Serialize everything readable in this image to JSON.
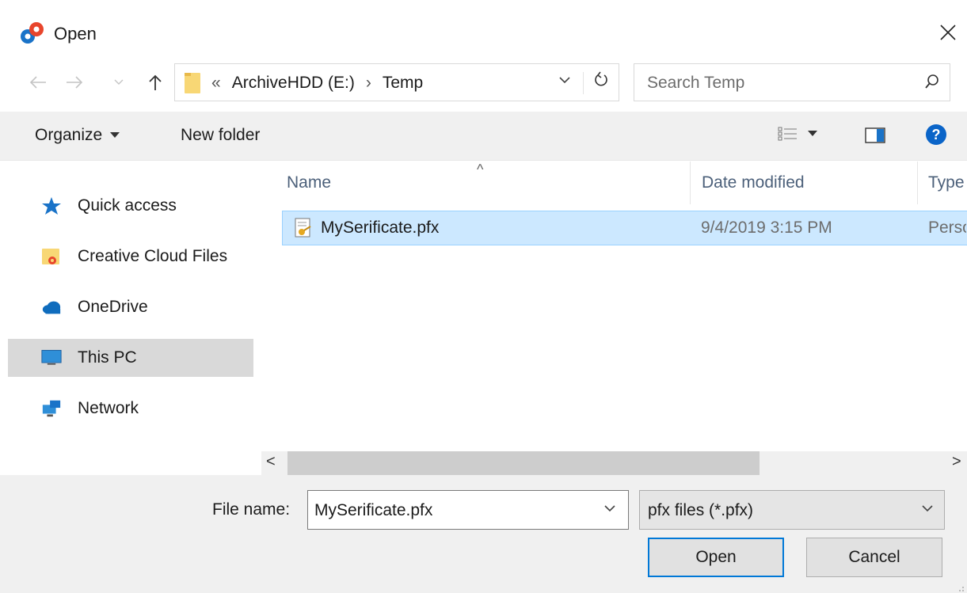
{
  "window": {
    "title": "Open",
    "app_icon": "app-gear-icon"
  },
  "navigation": {
    "back": "back-arrow-icon",
    "forward": "forward-arrow-icon",
    "recent": "chevron-down-icon",
    "up": "up-arrow-icon"
  },
  "address": {
    "overflow": "«",
    "crumbs": [
      "ArchiveHDD (E:)",
      "Temp"
    ],
    "separator": "›"
  },
  "search": {
    "placeholder": "Search Temp"
  },
  "toolbar": {
    "organize_label": "Organize",
    "new_folder_label": "New folder",
    "view_icon": "view-options-icon",
    "preview_icon": "preview-pane-icon",
    "help_icon": "help-icon"
  },
  "sidebar": {
    "items": [
      {
        "label": "Quick access",
        "icon": "star-icon",
        "selected": false
      },
      {
        "label": "Creative Cloud Files",
        "icon": "creative-cloud-folder-icon",
        "selected": false
      },
      {
        "label": "OneDrive",
        "icon": "cloud-icon",
        "selected": false
      },
      {
        "label": "This PC",
        "icon": "monitor-icon",
        "selected": true
      },
      {
        "label": "Network",
        "icon": "network-icon",
        "selected": false
      }
    ]
  },
  "filelist": {
    "columns": [
      "Name",
      "Date modified",
      "Type"
    ],
    "sort_indicator": "^",
    "rows": [
      {
        "name": "MySerificate.pfx",
        "date": "9/4/2019 3:15 PM",
        "type": "Personal Information Exchange",
        "icon": "certificate-file-icon",
        "selected": true
      }
    ]
  },
  "scroll": {
    "left": "<",
    "right": ">"
  },
  "footer": {
    "filename_label": "File name:",
    "filename_mnemonic": "n",
    "filename_value": "MySerificate.pfx",
    "filetype_value": "pfx files (*.pfx)",
    "open_label": "Open",
    "open_mnemonic": "O",
    "cancel_label": "Cancel"
  },
  "colors": {
    "selection_fill": "#cce8ff",
    "selection_border": "#99d1ff",
    "accent": "#0078d7",
    "toolbar_bg": "#f0f0f0"
  }
}
